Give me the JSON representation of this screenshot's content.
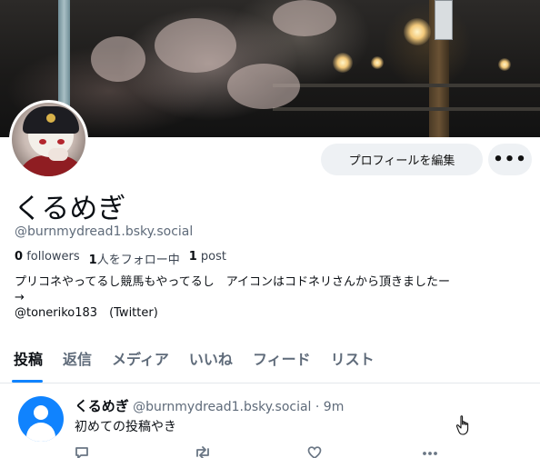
{
  "profile": {
    "display_name": "くるめぎ",
    "handle": "@burnmydread1.bsky.social",
    "followers_count": "0",
    "followers_label": "followers",
    "following_count": "1",
    "following_label": "人をフォロー中",
    "posts_count": "1",
    "posts_label": "post",
    "bio_line1": "プリコネやってるし競馬もやってるし　アイコンはコドネリさんから頂きましたー",
    "bio_line2": "→",
    "bio_line3": "@toneriko183　(Twitter)"
  },
  "buttons": {
    "edit_profile": "プロフィールを編集",
    "more": "•••"
  },
  "tabs": [
    {
      "label": "投稿",
      "active": true
    },
    {
      "label": "返信",
      "active": false
    },
    {
      "label": "メディア",
      "active": false
    },
    {
      "label": "いいね",
      "active": false
    },
    {
      "label": "フィード",
      "active": false
    },
    {
      "label": "リスト",
      "active": false
    }
  ],
  "post": {
    "author_name": "くるめぎ",
    "author_handle": "@burnmydread1.bsky.social",
    "separator": "·",
    "time": "9m",
    "text": "初めての投稿やき"
  },
  "colors": {
    "accent": "#1083fe",
    "muted_text": "#5f6b7a",
    "button_bg": "#eef1f4"
  },
  "icons": {
    "reply": "speech-bubble-icon",
    "repost": "repost-icon",
    "like": "heart-icon",
    "more": "ellipsis-icon",
    "cursor": "hand-pointer-icon"
  }
}
